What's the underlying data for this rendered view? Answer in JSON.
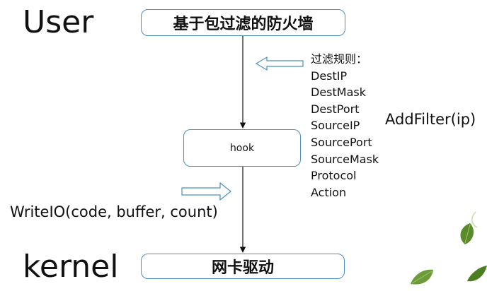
{
  "labels": {
    "user": "User",
    "kernel": "kernel"
  },
  "nodes": {
    "firewall": "基于包过滤的防火墙",
    "hook": "hook",
    "nic_driver": "网卡驱动"
  },
  "filter_rules": {
    "heading": "过滤规则：",
    "items": [
      "DestIP",
      "DestMask",
      "DestPort",
      "SourceIP",
      "SourcePort",
      "SourceMask",
      "Protocol",
      "Action"
    ]
  },
  "calls": {
    "add_filter": "AddFilter(ip)",
    "write_io": "WriteIO(code, buffer, count)"
  },
  "colors": {
    "box_border": "#4a90c2",
    "leaf_dark": "#5a8a2a",
    "leaf_light": "#9cc46b"
  }
}
